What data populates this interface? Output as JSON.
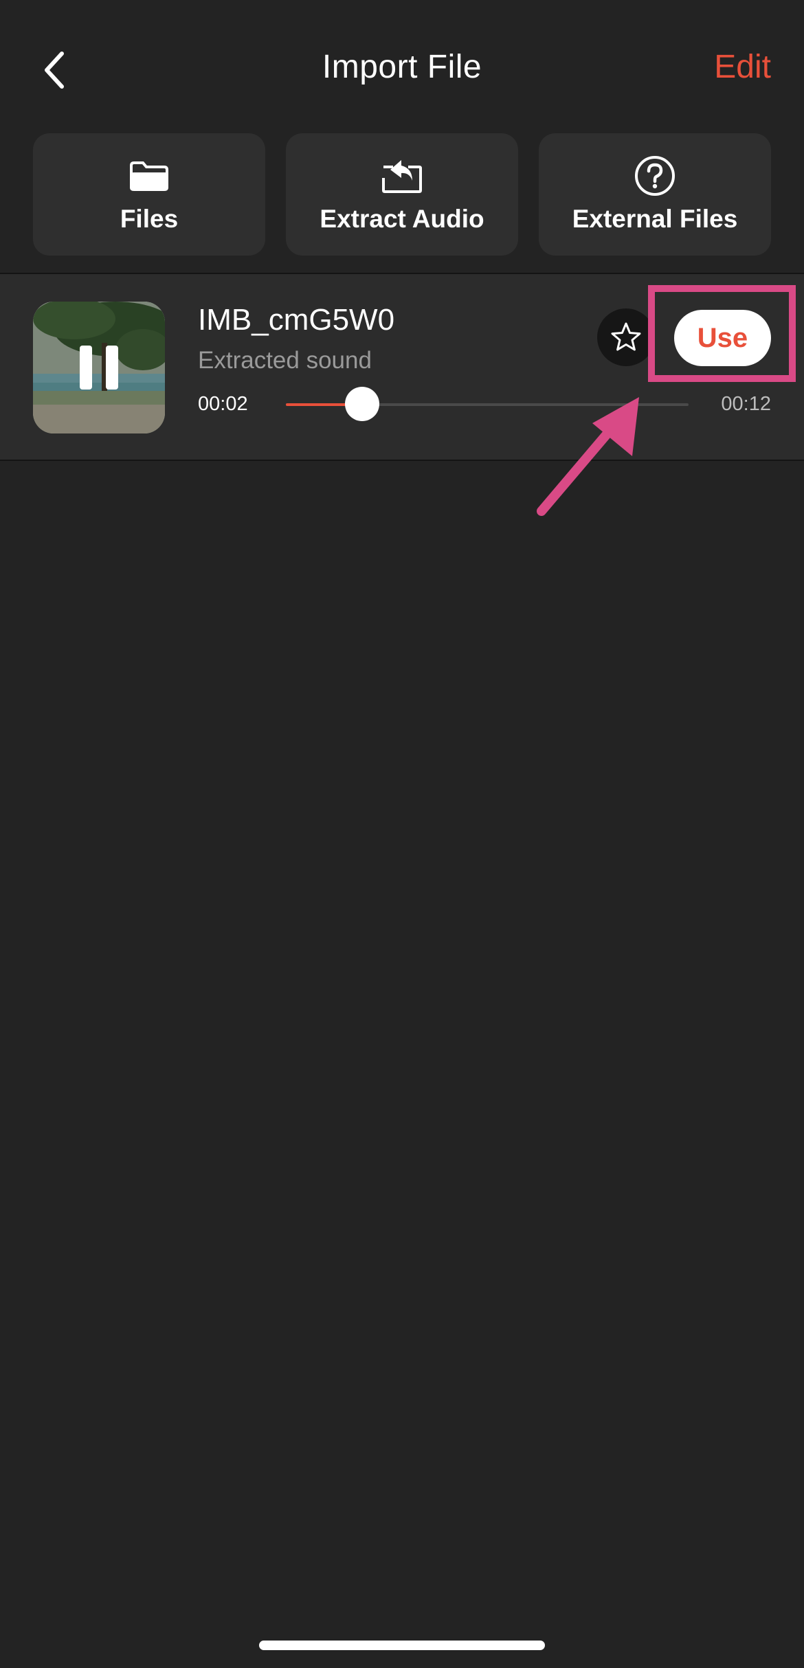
{
  "header": {
    "title": "Import File",
    "edit_label": "Edit",
    "back_icon": "chevron-left-icon"
  },
  "sources": [
    {
      "label": "Files",
      "icon": "folder-icon"
    },
    {
      "label": "Extract Audio",
      "icon": "extract-audio-icon"
    },
    {
      "label": "External Files",
      "icon": "help-circle-icon"
    }
  ],
  "audio_item": {
    "title": "IMB_cmG5W0",
    "subtitle": "Extracted sound",
    "current_time": "00:02",
    "total_time": "00:12",
    "progress": 0.19,
    "state": "playing",
    "use_label": "Use",
    "favorited": false
  },
  "colors": {
    "background": "#232323",
    "card": "#2f2f2f",
    "accent": "#e8503a",
    "annotation": "#d94a86"
  }
}
